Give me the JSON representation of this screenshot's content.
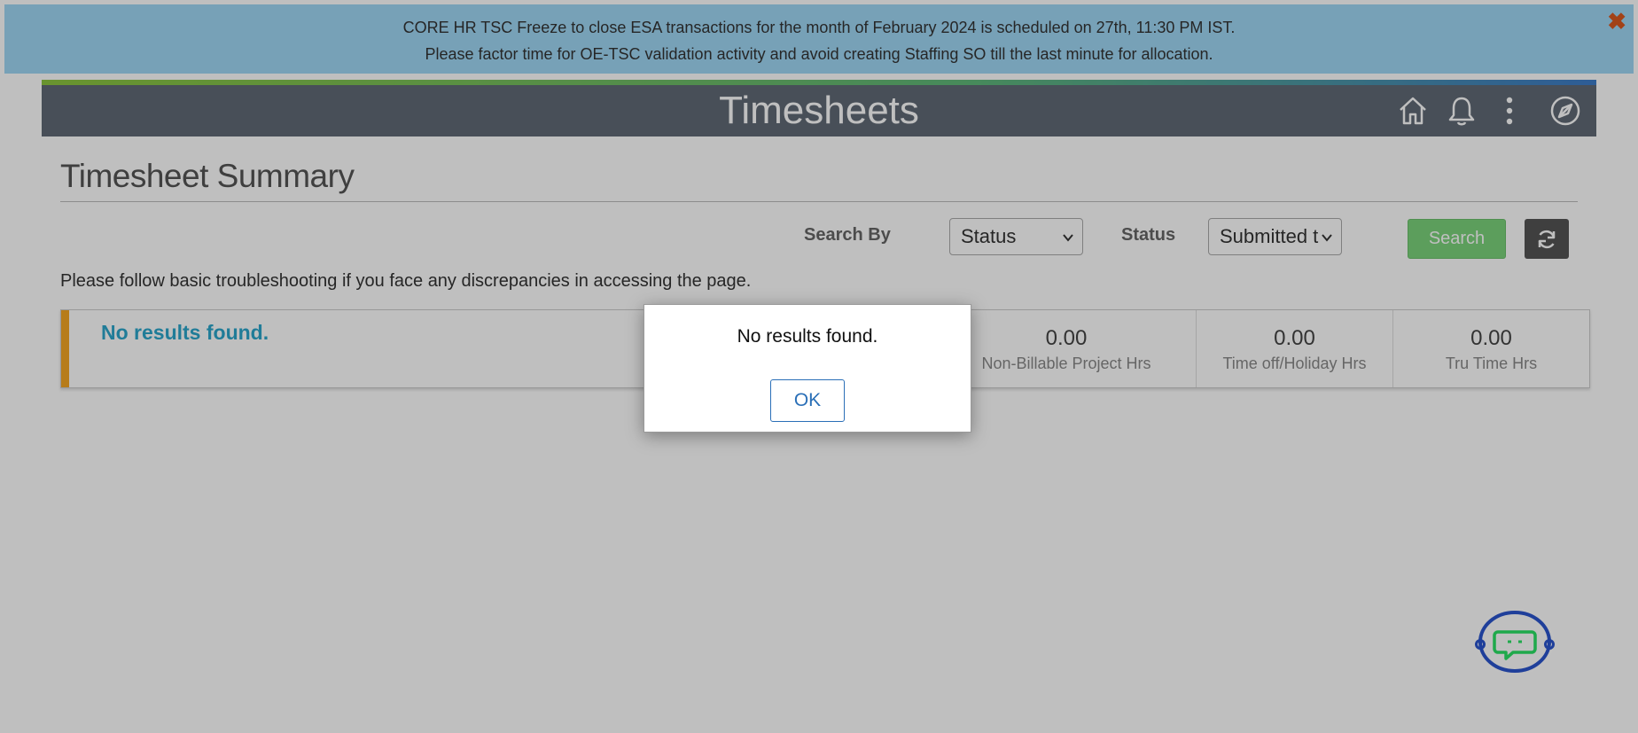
{
  "banner": {
    "line1": "CORE HR TSC Freeze to close ESA transactions for the month of February 2024 is scheduled on 27th, 11:30 PM IST.",
    "line2": "Please factor time for OE-TSC validation activity and avoid creating Staffing SO till the last minute for allocation.",
    "close_icon": "close-icon"
  },
  "header": {
    "title": "Timesheets",
    "icons": [
      "home-icon",
      "bell-icon",
      "more-vertical-icon",
      "compass-icon"
    ]
  },
  "page": {
    "title": "Timesheet Summary",
    "note": "Please follow basic troubleshooting if you face any discrepancies in accessing the page."
  },
  "filters": {
    "search_by_label": "Search By",
    "search_by_value": "Status",
    "status_label": "Status",
    "status_value": "Submitted t",
    "search_button": "Search",
    "refresh_icon": "refresh-icon"
  },
  "results": {
    "empty_text": "No results found.",
    "metrics": [
      {
        "value": "0.00",
        "caption": "Non-Billable Project Hrs"
      },
      {
        "value": "0.00",
        "caption": "Time off/Holiday Hrs"
      },
      {
        "value": "0.00",
        "caption": "Tru Time Hrs"
      }
    ]
  },
  "dialog": {
    "message": "No results found.",
    "ok_label": "OK"
  },
  "colors": {
    "banner_bg": "#9fd7f5",
    "header_bg": "#616a76",
    "search_button": "#7bd37b",
    "accent_bar": "#f5a623",
    "link_blue": "#2ba6cb",
    "close_orange": "#d9581f"
  }
}
